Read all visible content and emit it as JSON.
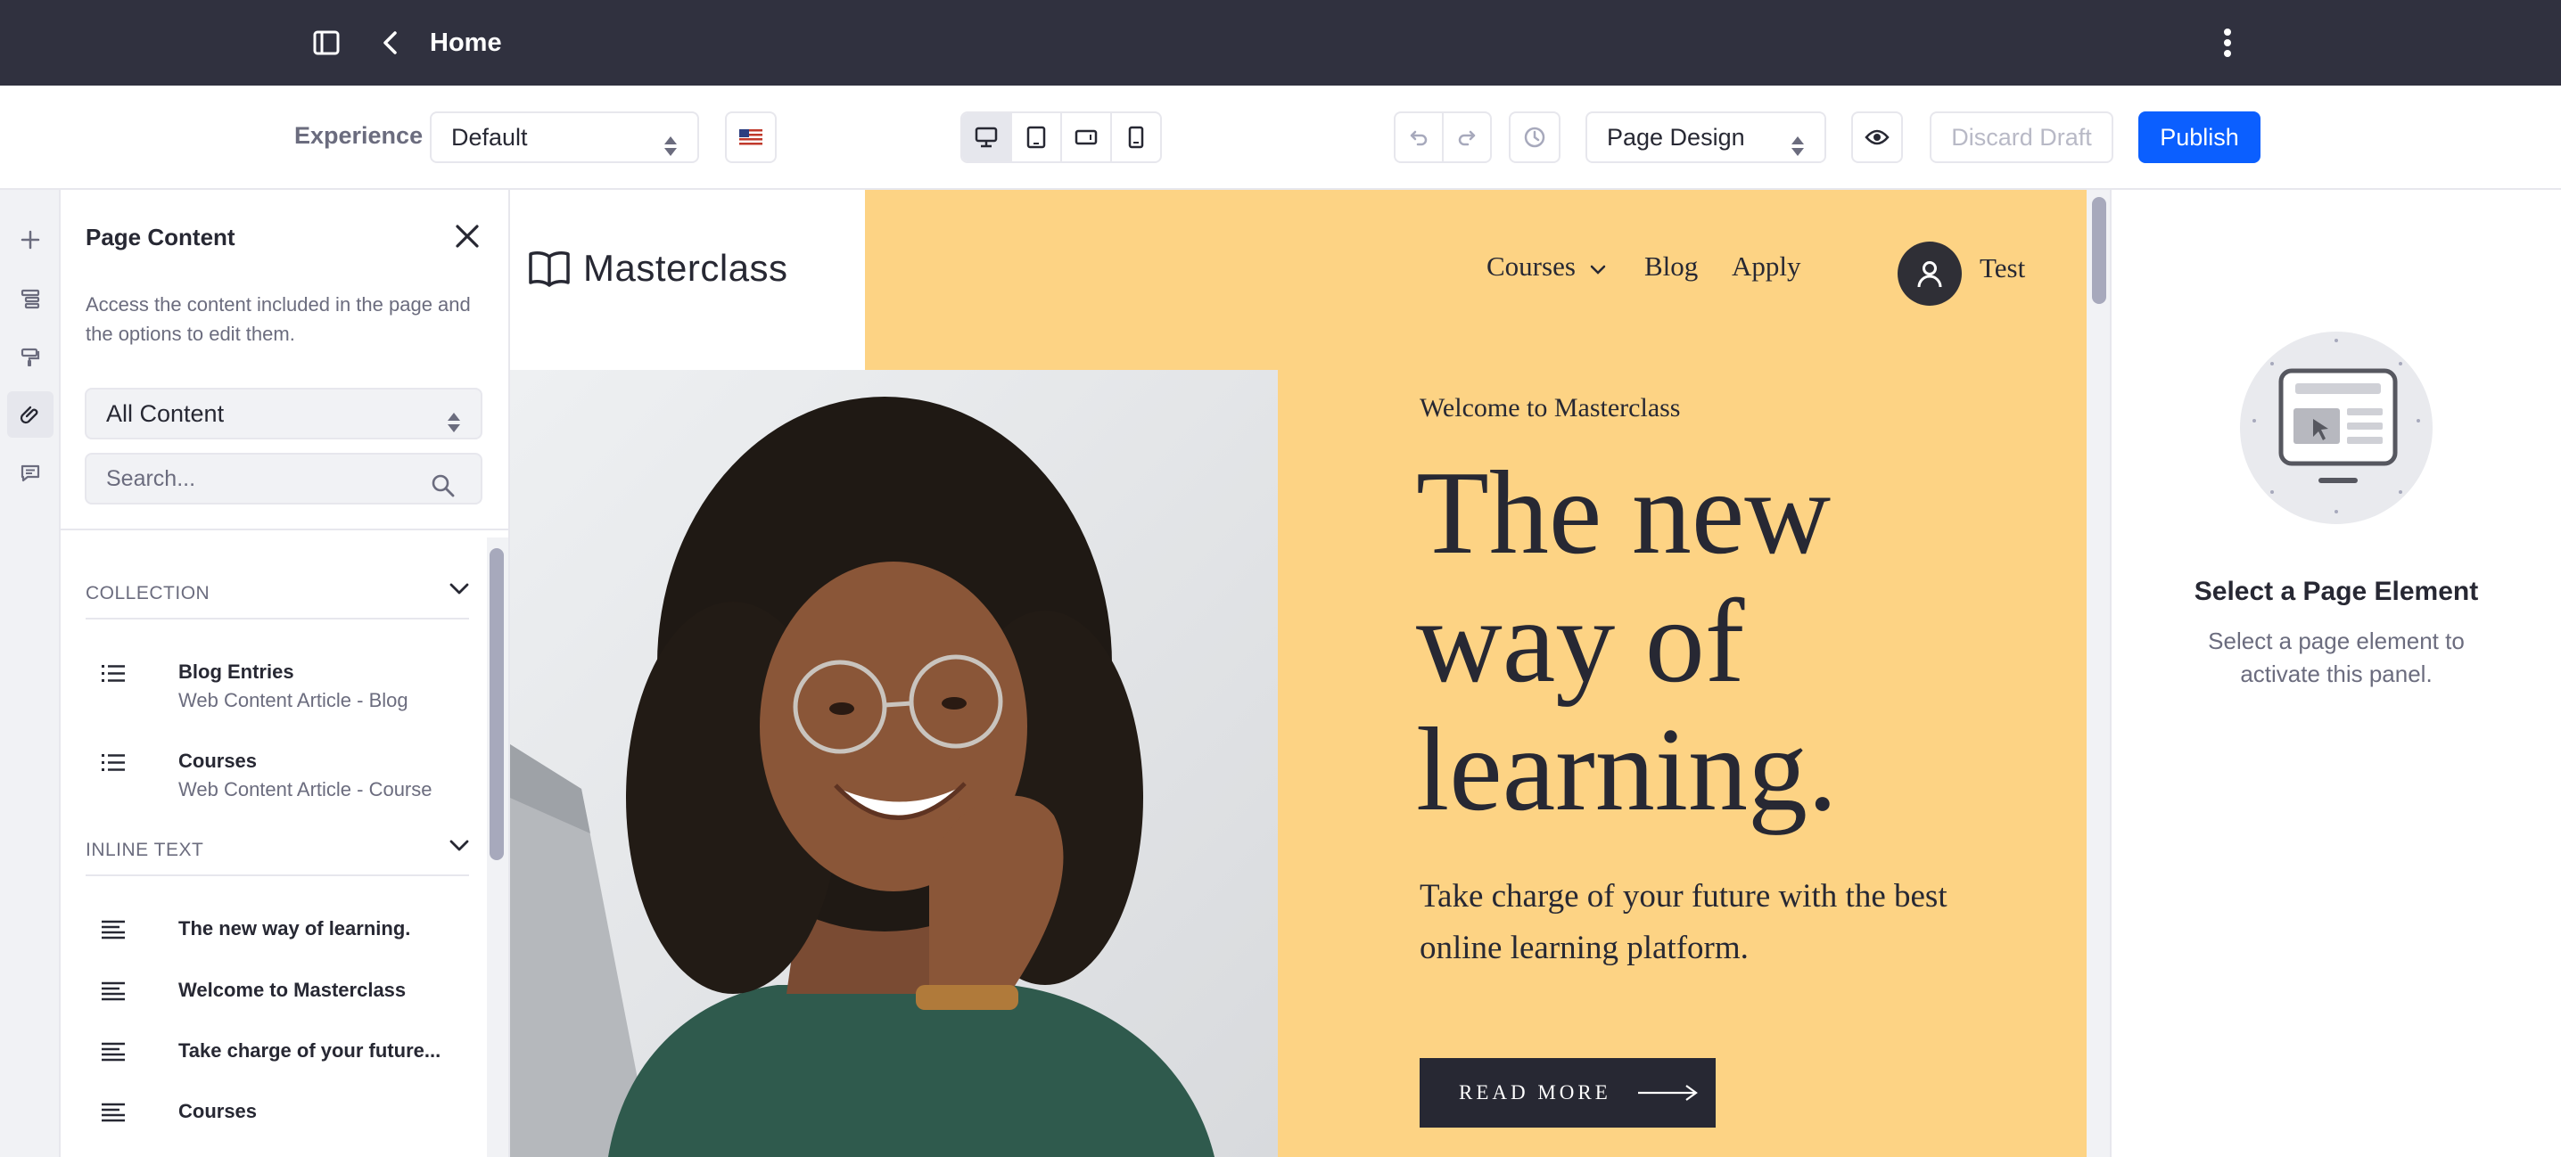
{
  "topbar": {
    "title": "Home"
  },
  "toolbar": {
    "experience_label": "Experience",
    "experience_value": "Default",
    "mode_value": "Page Design",
    "discard_label": "Discard Draft",
    "publish_label": "Publish"
  },
  "panel": {
    "title": "Page Content",
    "description": "Access the content included in the page and the options to edit them.",
    "filter_value": "All Content",
    "search_placeholder": "Search...",
    "sections": [
      {
        "label": "COLLECTION",
        "items": [
          {
            "title": "Blog Entries",
            "subtitle": "Web Content Article - Blog"
          },
          {
            "title": "Courses",
            "subtitle": "Web Content Article - Course"
          }
        ]
      },
      {
        "label": "INLINE TEXT",
        "items": [
          {
            "title": "The new way of learning."
          },
          {
            "title": "Welcome to Masterclass"
          },
          {
            "title": "Take charge of your future..."
          },
          {
            "title": "Courses"
          }
        ]
      }
    ]
  },
  "site": {
    "logo_text": "Masterclass",
    "nav": [
      "Courses",
      "Blog",
      "Apply"
    ],
    "user_name": "Test",
    "welcome": "Welcome to Masterclass",
    "hero_title": "The new way of learning.",
    "hero_sub": "Take charge of your future with the best online learning platform.",
    "cta": "READ MORE"
  },
  "right_panel": {
    "title": "Select a Page Element",
    "text": "Select a page element to activate this panel."
  },
  "colors": {
    "topbar": "#30313f",
    "accent": "#0b5fff",
    "hero_bg": "#fdd384"
  }
}
